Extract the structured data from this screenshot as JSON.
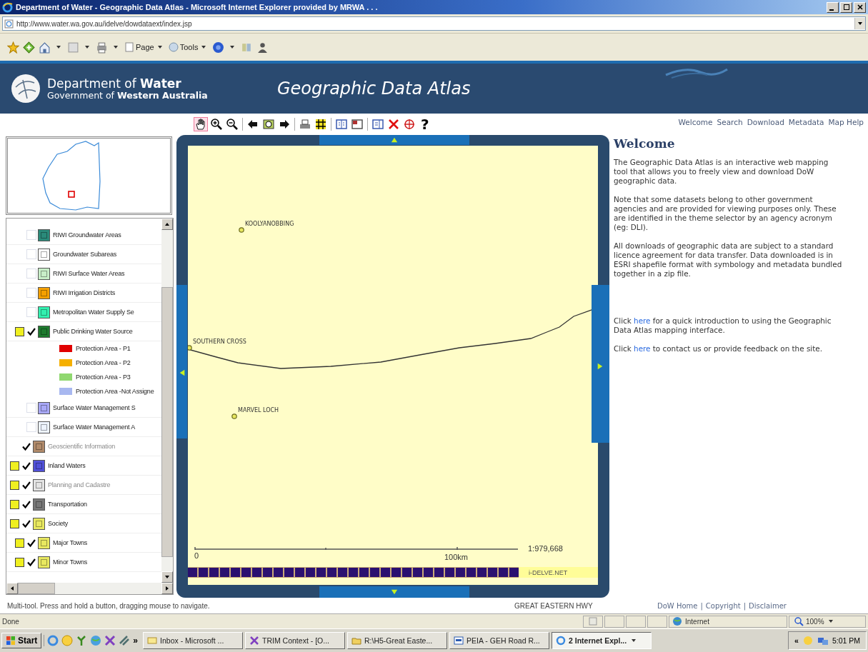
{
  "window": {
    "title": "Department of Water - Geographic Data Atlas - Microsoft Internet Explorer provided by MRWA . . .",
    "address": "http://www.water.wa.gov.au/idelve/dowdataext/index.jsp"
  },
  "command_bar": {
    "menus": [
      "Page",
      "Tools"
    ]
  },
  "header": {
    "org_line1": "Department of **Water**",
    "org_line2": "Government of **Western Australia**",
    "app_title": "Geographic Data Atlas"
  },
  "map_tools": [
    {
      "selected": true
    },
    {
      "selected": false
    },
    {
      "selected": false
    },
    {
      "selected": false
    },
    {
      "selected": false
    },
    {
      "selected": false
    },
    {
      "selected": false
    },
    {
      "selected": false
    },
    {
      "selected": false
    },
    {
      "selected": false
    },
    {
      "selected": false
    },
    {
      "selected": false
    },
    {
      "selected": false
    }
  ],
  "help_glyph": "?",
  "nav_links": [
    "Welcome",
    "Search",
    "Download",
    "Metadata",
    "Map Help"
  ],
  "layers": [
    {
      "kind": "layer",
      "label": "RIWI Groundwater Areas",
      "selected": false,
      "checked": false,
      "disabled": false,
      "color": "#2a8a7a"
    },
    {
      "kind": "layer",
      "label": "Groundwater Subareas",
      "selected": false,
      "checked": false,
      "disabled": false,
      "color": "#ffffff"
    },
    {
      "kind": "layer",
      "label": "RIWI Surface Water Areas",
      "selected": false,
      "checked": false,
      "disabled": false,
      "color": "#c8eec8"
    },
    {
      "kind": "layer",
      "label": "RIWI Irrigation Districts",
      "selected": false,
      "checked": false,
      "disabled": false,
      "color": "#f5a000"
    },
    {
      "kind": "layer",
      "label": "Metropolitan Water Supply Se",
      "selected": false,
      "checked": false,
      "disabled": false,
      "color": "#33f0b0"
    },
    {
      "kind": "layer",
      "label": "Public Drinking Water Source",
      "selected": true,
      "checked": true,
      "disabled": false,
      "color": "#1e7a2e",
      "children": [
        {
          "kind": "legend",
          "label": "Protection Area - P1",
          "color": "#e00000"
        },
        {
          "kind": "legend",
          "label": "Protection Area - P2",
          "color": "#f5b000"
        },
        {
          "kind": "legend",
          "label": "Protection Area - P3",
          "color": "#90d870"
        },
        {
          "kind": "legend",
          "label": "Protection Area -Not Assigne",
          "color": "#a8b8f0"
        }
      ]
    },
    {
      "kind": "layer",
      "label": "Surface Water Management S",
      "selected": false,
      "checked": false,
      "disabled": false,
      "color": "#a8a8f8"
    },
    {
      "kind": "layer",
      "label": "Surface Water Management A",
      "selected": false,
      "checked": false,
      "disabled": false,
      "color": "#eef4ff"
    },
    {
      "kind": "theme",
      "label": "Geoscientific Information",
      "selected": false,
      "checked": true,
      "disabled": true,
      "color": "#b08a6a"
    },
    {
      "kind": "theme",
      "label": "Inland Waters",
      "selected": true,
      "checked": true,
      "disabled": false,
      "color": "#5050d8"
    },
    {
      "kind": "theme",
      "label": "Planning and Cadastre",
      "selected": true,
      "checked": true,
      "disabled": true,
      "color": "#e4e4e4"
    },
    {
      "kind": "theme",
      "label": "Transportation",
      "selected": true,
      "checked": true,
      "disabled": false,
      "color": "#777777"
    },
    {
      "kind": "theme",
      "label": "Society",
      "selected": true,
      "checked": true,
      "disabled": false,
      "color": "#e8e860",
      "children": [
        {
          "kind": "layer",
          "label": "Major Towns",
          "selected": true,
          "checked": true,
          "disabled": false,
          "color": "#e8e860"
        },
        {
          "kind": "layer",
          "label": "Minor Towns",
          "selected": true,
          "checked": true,
          "disabled": false,
          "color": "#e8e860"
        }
      ]
    }
  ],
  "map": {
    "places": [
      "KOOLYANOBBING",
      "SOUTHERN CROSS",
      "MARVEL LOCH"
    ],
    "scale_start": "0",
    "scale_end": "100km",
    "scale_ratio": "1:979,668",
    "credit": "i-DELVE.NET"
  },
  "welcome": {
    "heading": "Welcome",
    "paragraphs": [
      {
        "text": "The Geographic Data Atlas is an interactive web mapping tool that allows you to freely view and download DoW geographic data."
      },
      {
        "text": "Note that some datasets belong to other government agencies and are provided for viewing purposes only. These are identified in the theme selector by an agency acronym (eg: DLI)."
      },
      {
        "text": "All downloads of geographic data are subject to a standard licence agreement for data transfer. Data downloaded is in ESRI shapefile format with symbology and metadata bundled together in a zip file."
      }
    ],
    "link_paragraphs": [
      {
        "before": "Click",
        "link": "here",
        "after": "for a quick introduction to using the Geographic Data Atlas mapping interface."
      },
      {
        "before": "Click",
        "link": "here",
        "after": "to contact us or provide feedback on the site."
      }
    ]
  },
  "status_hint": "Multi-tool. Press and hold a button, dragging mouse to navigate.",
  "road_name": "GREAT EASTERN HWY",
  "footer_links": [
    "DoW Home",
    "Copyright",
    "Disclaimer"
  ],
  "footer_separator": "|",
  "status_bar": {
    "text": "Done",
    "zone": "Internet",
    "zoom": "100%"
  },
  "taskbar": {
    "start": "Start",
    "more": "»",
    "tasks": [
      {
        "label": "Inbox - Microsoft ...",
        "selected": false
      },
      {
        "label": "TRIM Context - [O...",
        "selected": false
      },
      {
        "label": "R:\\H5-Great Easte...",
        "selected": false
      },
      {
        "label": "PEIA - GEH Road R...",
        "selected": false
      },
      {
        "label": "2 Internet Expl...",
        "selected": true
      }
    ],
    "tray_more": "«",
    "clock": "5:01 PM"
  }
}
